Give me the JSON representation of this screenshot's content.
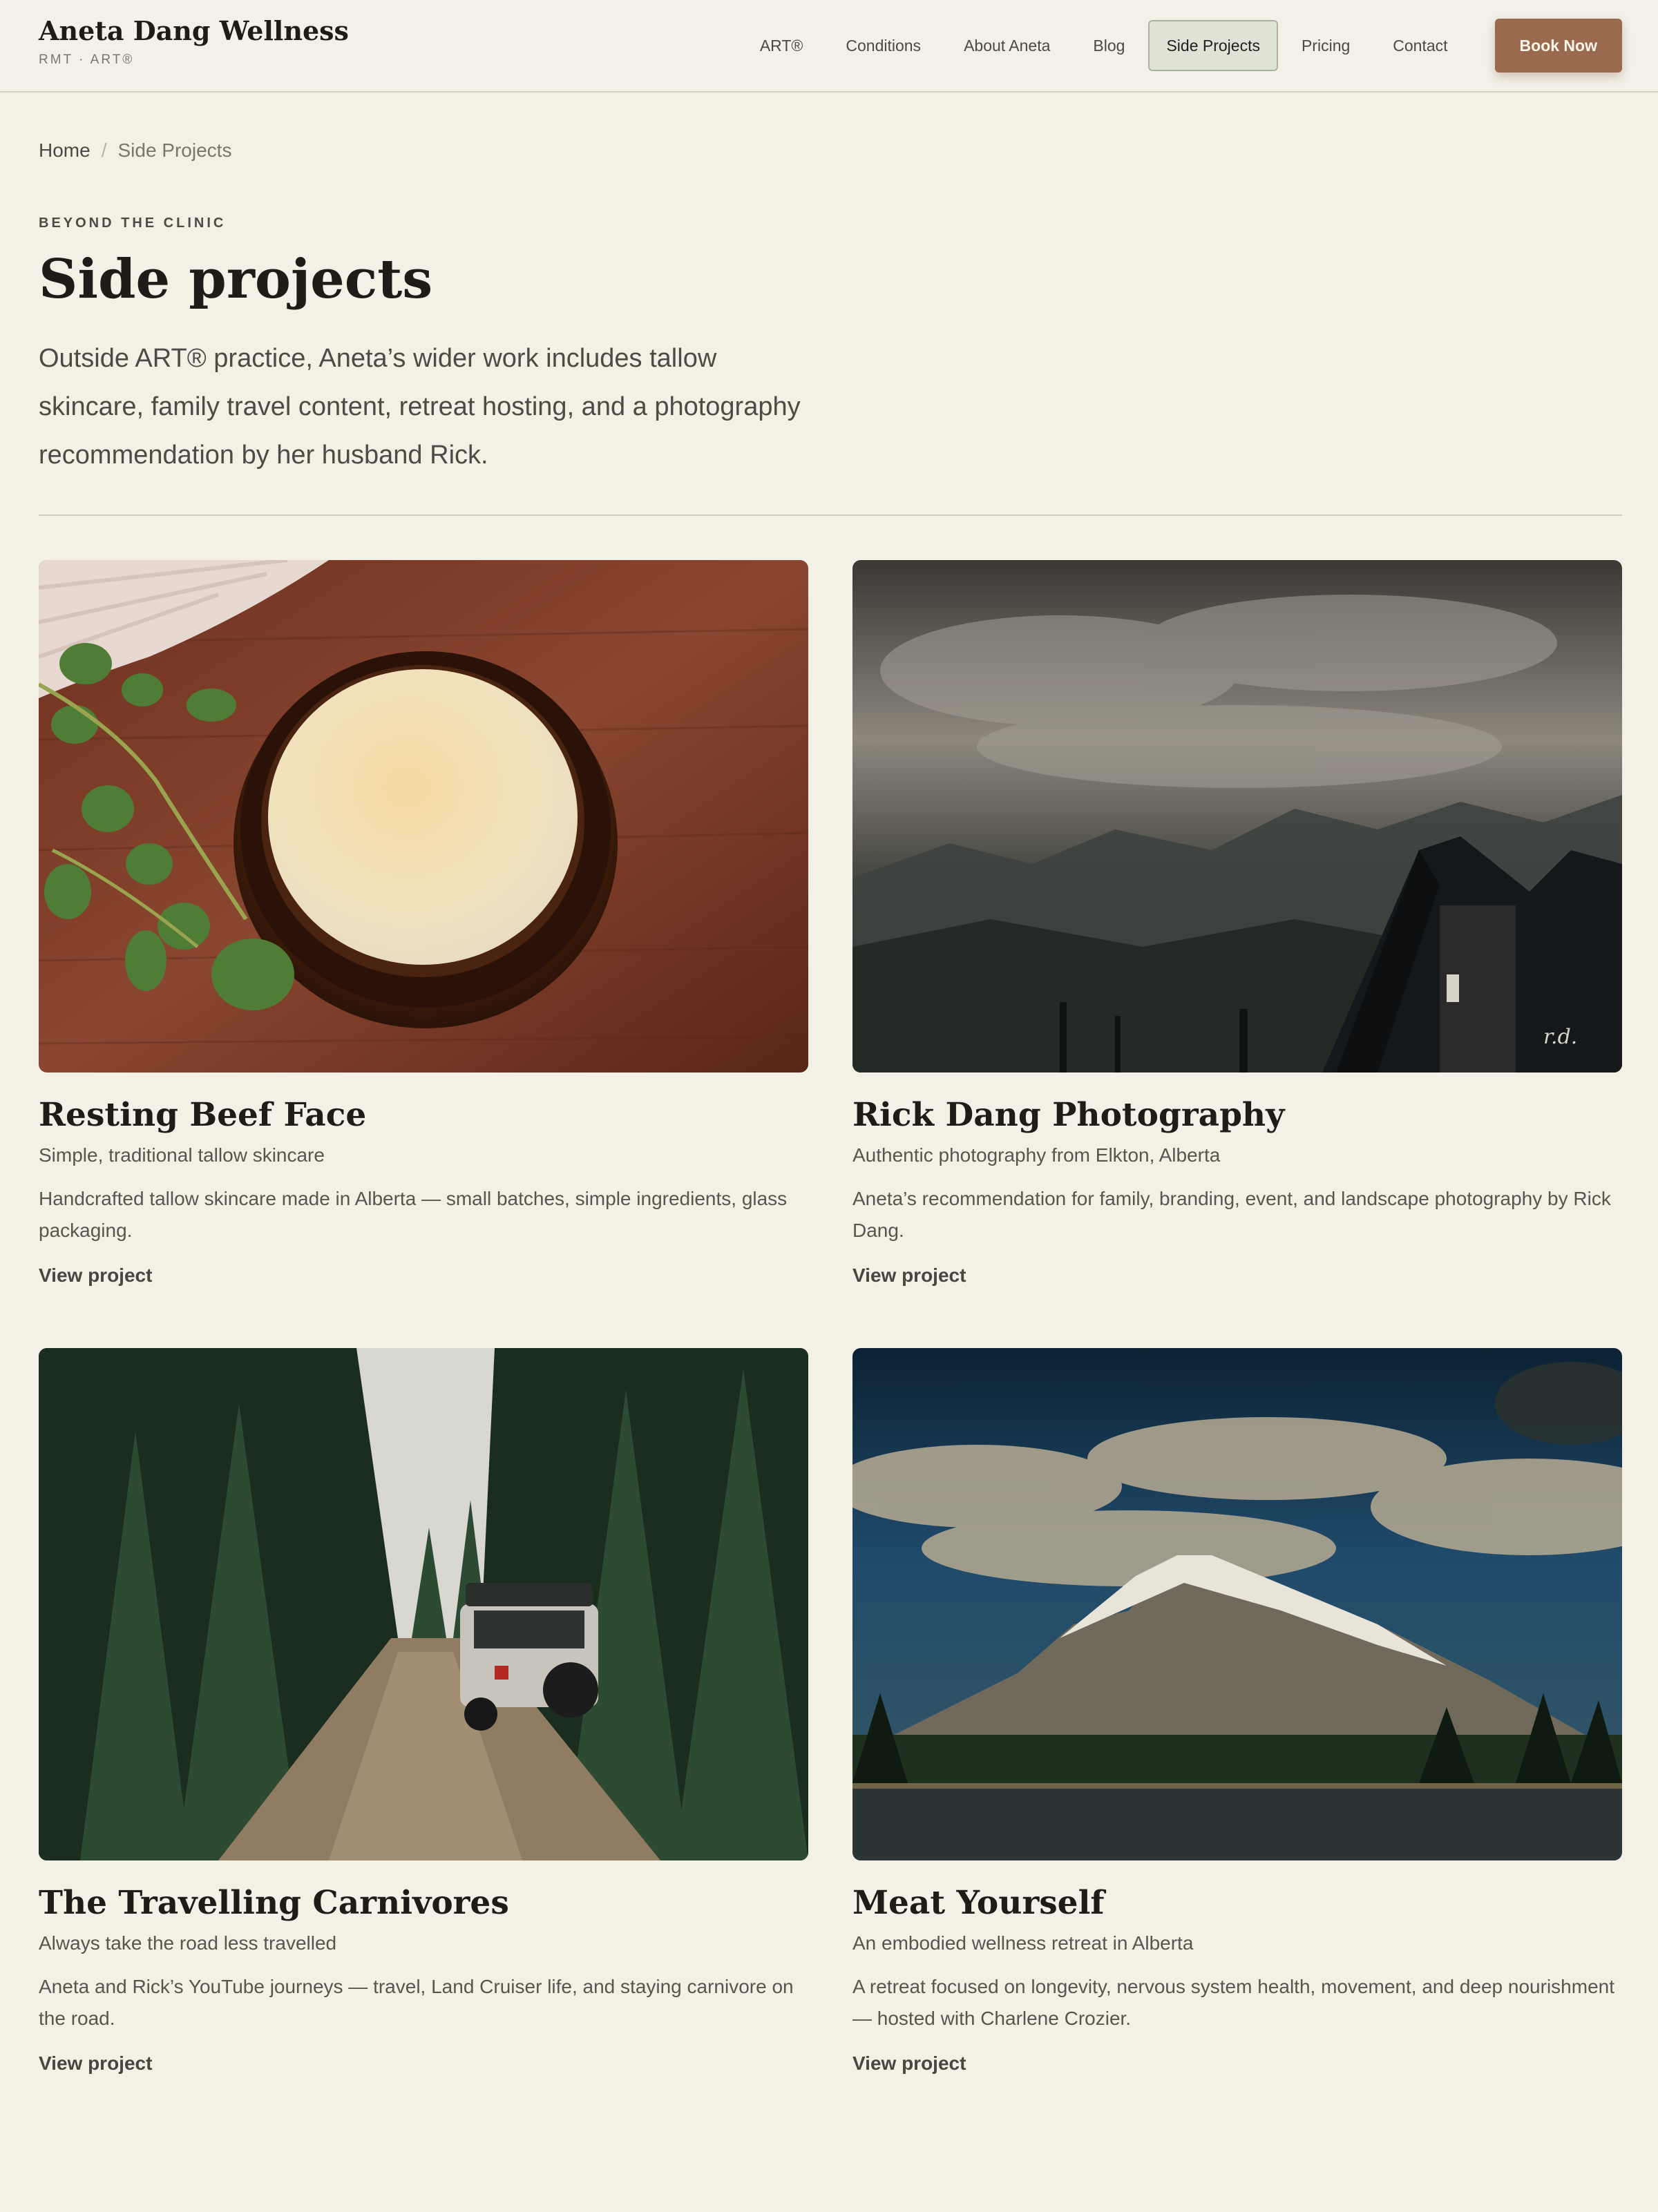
{
  "header": {
    "brand_name": "Aneta Dang Wellness",
    "brand_sub": "RMT · ART®",
    "nav": [
      {
        "label": "ART®"
      },
      {
        "label": "Conditions"
      },
      {
        "label": "About Aneta"
      },
      {
        "label": "Blog"
      },
      {
        "label": "Side Projects",
        "active": true
      },
      {
        "label": "Pricing"
      },
      {
        "label": "Contact"
      }
    ],
    "cta_label": "Book Now"
  },
  "breadcrumb": {
    "home": "Home",
    "separator": "/",
    "current": "Side Projects"
  },
  "hero": {
    "eyebrow": "BEYOND THE CLINIC",
    "title": "Side projects",
    "intro": "Outside ART® practice, Aneta’s wider work includes tallow skincare, family travel content, retreat hosting, and a photography recommendation by her husband Rick."
  },
  "projects": [
    {
      "title": "Resting Beef Face",
      "tagline": "Simple, traditional tallow skincare",
      "description": "Handcrafted tallow skincare made in Alberta — small batches, simple ingredients, glass packaging.",
      "link_label": "View project"
    },
    {
      "title": "Rick Dang Photography",
      "tagline": "Authentic photography from Elkton, Alberta",
      "description": "Aneta’s recommendation for family, branding, event, and landscape photography by Rick Dang.",
      "link_label": "View project"
    },
    {
      "title": "The Travelling Carnivores",
      "tagline": "Always take the road less travelled",
      "description": "Aneta and Rick’s YouTube journeys — travel, Land Cruiser life, and staying carnivore on the road.",
      "link_label": "View project"
    },
    {
      "title": "Meat Yourself",
      "tagline": "An embodied wellness retreat in Alberta",
      "description": "A retreat focused on longevity, nervous system health, movement, and deep nourishment — hosted with Charlene Crozier.",
      "link_label": "View project"
    }
  ],
  "colors": {
    "background": "#f3f0e6",
    "accent": "#9a6a4f",
    "active_nav": "#dfe3d6",
    "heading": "#1f1c18"
  }
}
